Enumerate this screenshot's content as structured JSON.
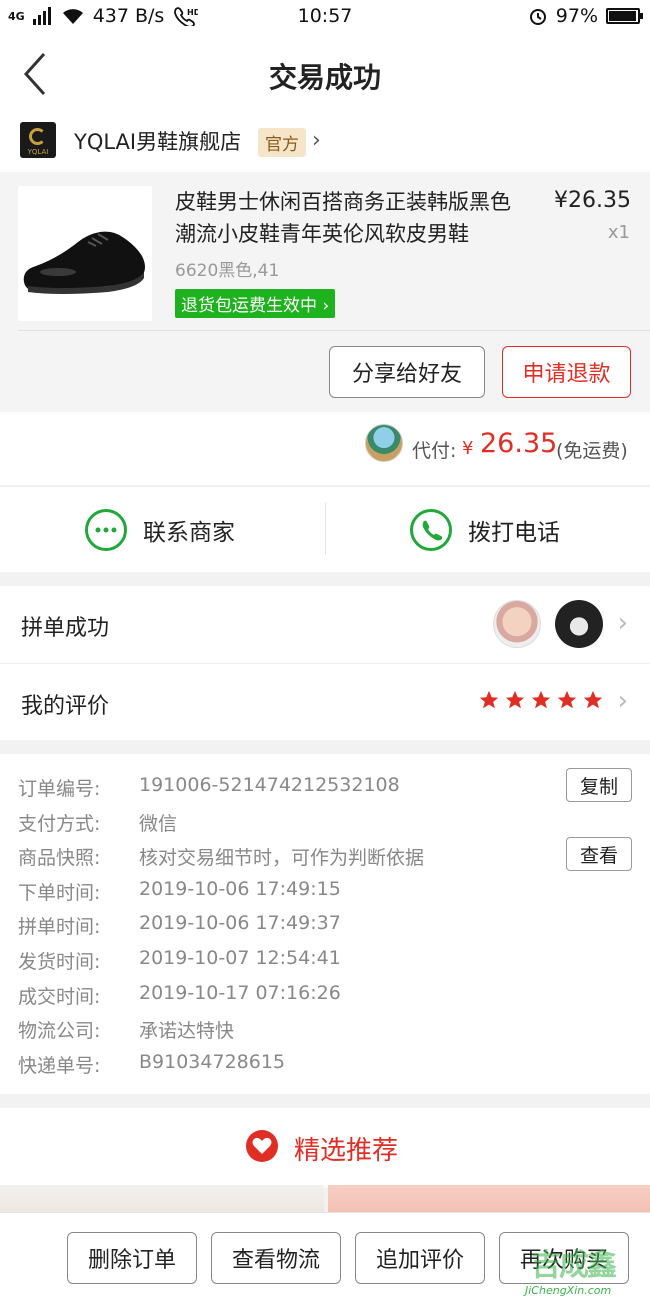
{
  "status_bar": {
    "network": "4G",
    "speed": "437 B/s",
    "hd": "HD",
    "time": "10:57",
    "battery_text": "97%",
    "battery_level": 0.97
  },
  "header": {
    "title": "交易成功"
  },
  "store": {
    "logo_text": "YQLAI",
    "name": "YQLAI男鞋旗舰店",
    "badge": "官方"
  },
  "product": {
    "title": "皮鞋男士休闲百搭商务正装韩版黑色潮流小皮鞋青年英伦风软皮男鞋",
    "price": "¥26.35",
    "qty": "x1",
    "spec": "6620黑色,41",
    "return_badge": "退货包运费生效中"
  },
  "actions": {
    "share": "分享给好友",
    "refund": "申请退款"
  },
  "payment": {
    "label": "代付:",
    "currency": "¥",
    "amount": "26.35",
    "note": "(免运费)"
  },
  "contact": {
    "merchant": "联系商家",
    "phone": "拨打电话"
  },
  "group": {
    "label": "拼单成功"
  },
  "review": {
    "label": "我的评价",
    "stars": 5,
    "star_color": "#e02e24"
  },
  "order_info": [
    {
      "label": "订单编号:",
      "value": "191006-521474212532108",
      "button": "复制"
    },
    {
      "label": "支付方式:",
      "value": "微信"
    },
    {
      "label": "商品快照:",
      "value": "核对交易细节时，可作为判断依据",
      "button": "查看"
    },
    {
      "label": "下单时间:",
      "value": "2019-10-06 17:49:15"
    },
    {
      "label": "拼单时间:",
      "value": "2019-10-06 17:49:37"
    },
    {
      "label": "发货时间:",
      "value": "2019-10-07 12:54:41"
    },
    {
      "label": "成交时间:",
      "value": "2019-10-17 07:16:26"
    },
    {
      "label": "物流公司:",
      "value": "承诺达特快"
    },
    {
      "label": "快递单号:",
      "value": "B91034728615"
    }
  ],
  "recommend": {
    "title": "精选推荐"
  },
  "bottom_bar": {
    "delete": "删除订单",
    "logistics": "查看物流",
    "add_review": "追加评价",
    "buy_again": "再次购买"
  },
  "watermark": {
    "text": "JiChengXin.com",
    "chars": "吉成鑫"
  },
  "colors": {
    "accent": "#e02e24",
    "green": "#22a83a",
    "badge_green": "#1fb21f"
  }
}
